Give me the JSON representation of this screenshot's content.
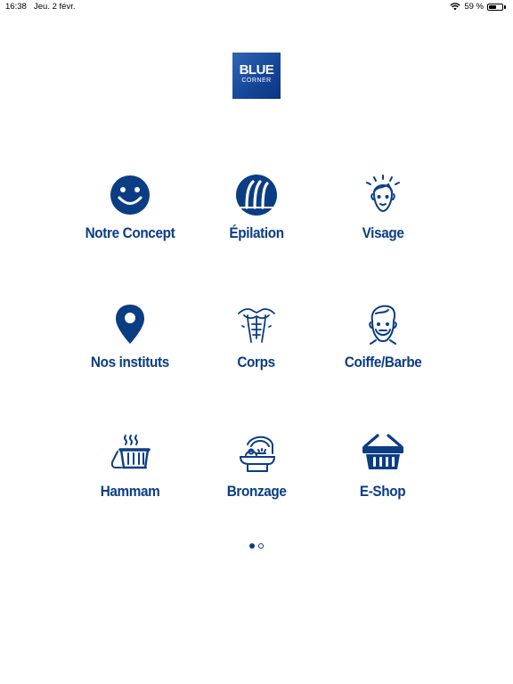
{
  "status_bar": {
    "time": "16:38",
    "date": "Jeu. 2 févr.",
    "battery": "59 %",
    "battery_level": 0.59
  },
  "logo": {
    "line1": "BLUE",
    "line2": "CORNER"
  },
  "menu": [
    {
      "label": "Notre Concept",
      "icon": "smiley-face-icon"
    },
    {
      "label": "Épilation",
      "icon": "hair-follicle-icon"
    },
    {
      "label": "Visage",
      "icon": "face-glow-icon"
    },
    {
      "label": "Nos instituts",
      "icon": "location-pin-icon"
    },
    {
      "label": "Corps",
      "icon": "torso-icon"
    },
    {
      "label": "Coiffe/Barbe",
      "icon": "bearded-man-icon"
    },
    {
      "label": "Hammam",
      "icon": "steam-bath-icon"
    },
    {
      "label": "Bronzage",
      "icon": "tanning-bed-icon"
    },
    {
      "label": "E-Shop",
      "icon": "shopping-basket-icon"
    }
  ],
  "pager": {
    "pages": 2,
    "current": 1
  },
  "colors": {
    "brand": "#0a3d84",
    "logo_bg": "#17479a",
    "background": "#ffffff"
  }
}
